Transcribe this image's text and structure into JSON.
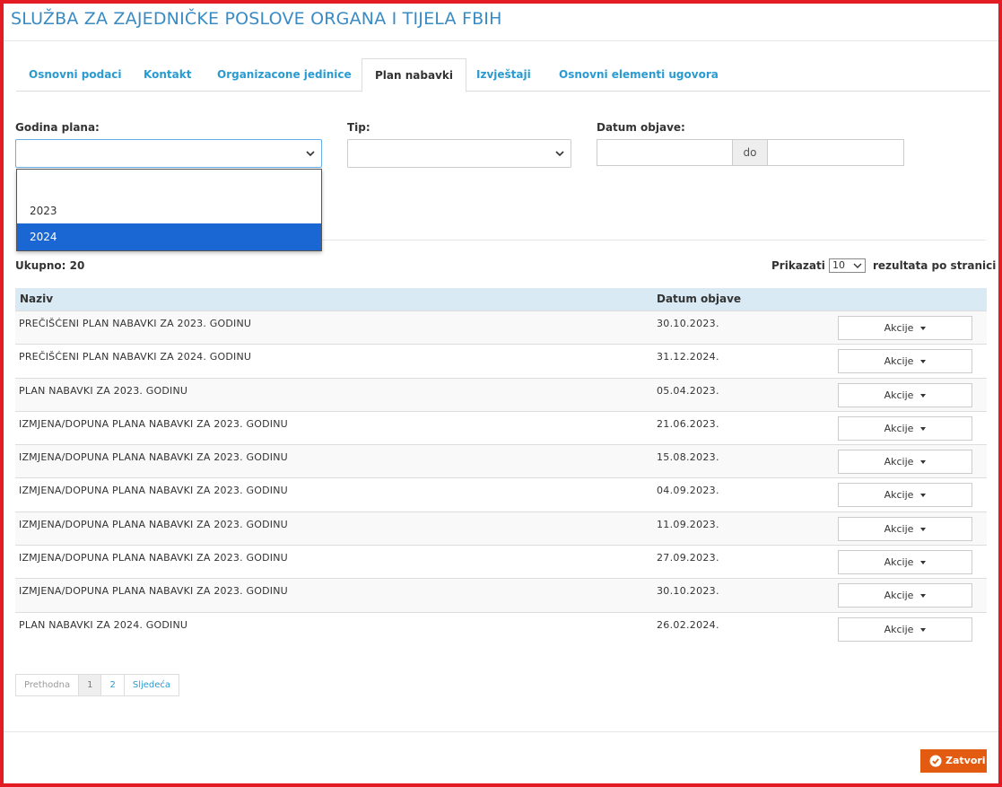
{
  "page_title": "SLUŽBA ZA ZAJEDNIČKE POSLOVE ORGANA I TIJELA FBIH",
  "tabs": [
    {
      "label": "Osnovni podaci"
    },
    {
      "label": "Kontakt"
    },
    {
      "label": "Organizacone jedinice"
    },
    {
      "label": "Plan nabavki"
    },
    {
      "label": "Izvještaji"
    },
    {
      "label": "Osnovni elementi ugovora"
    }
  ],
  "active_tab": "Plan nabavki",
  "filters": {
    "godina_label": "Godina plana:",
    "godina_value": "",
    "tip_label": "Tip:",
    "tip_value": "",
    "datum_label": "Datum objave:",
    "datum_from": "",
    "datum_sep": "do",
    "datum_to": ""
  },
  "godina_options": [
    "",
    "2023",
    "2024"
  ],
  "godina_highlighted": "2024",
  "summary": {
    "total": "Ukupno: 20",
    "show_label": "Prikazati",
    "per_page": "10",
    "per_page_suffix": "rezultata po stranici"
  },
  "table": {
    "columns": [
      "Naziv",
      "Datum objave"
    ],
    "action_label": "Akcije",
    "rows": [
      {
        "naziv": "PREČIŠĆENI PLAN NABAVKI ZA 2023. GODINU",
        "datum": "30.10.2023."
      },
      {
        "naziv": "PREČIŠĆENI PLAN NABAVKI ZA 2024. GODINU",
        "datum": "31.12.2024."
      },
      {
        "naziv": "PLAN NABAVKI ZA 2023. GODINU",
        "datum": "05.04.2023."
      },
      {
        "naziv": "IZMJENA/DOPUNA PLANA NABAVKI ZA 2023. GODINU",
        "datum": "21.06.2023."
      },
      {
        "naziv": "IZMJENA/DOPUNA PLANA NABAVKI ZA 2023. GODINU",
        "datum": "15.08.2023."
      },
      {
        "naziv": "IZMJENA/DOPUNA PLANA NABAVKI ZA 2023. GODINU",
        "datum": "04.09.2023."
      },
      {
        "naziv": "IZMJENA/DOPUNA PLANA NABAVKI ZA 2023. GODINU",
        "datum": "11.09.2023."
      },
      {
        "naziv": "IZMJENA/DOPUNA PLANA NABAVKI ZA 2023. GODINU",
        "datum": "27.09.2023."
      },
      {
        "naziv": "IZMJENA/DOPUNA PLANA NABAVKI ZA 2023. GODINU",
        "datum": "30.10.2023."
      },
      {
        "naziv": "PLAN NABAVKI ZA 2024. GODINU",
        "datum": "26.02.2024."
      }
    ]
  },
  "pagination": [
    "Prethodna",
    "1",
    "2",
    "Sljedeća"
  ],
  "active_page": "1",
  "close_label": "Zatvori",
  "colors": {
    "accent": "#2a9bd1",
    "title": "#3a8bc4",
    "close_button": "#e35a11",
    "selected_option": "#1a66d2",
    "frame_border": "#e31b23"
  }
}
